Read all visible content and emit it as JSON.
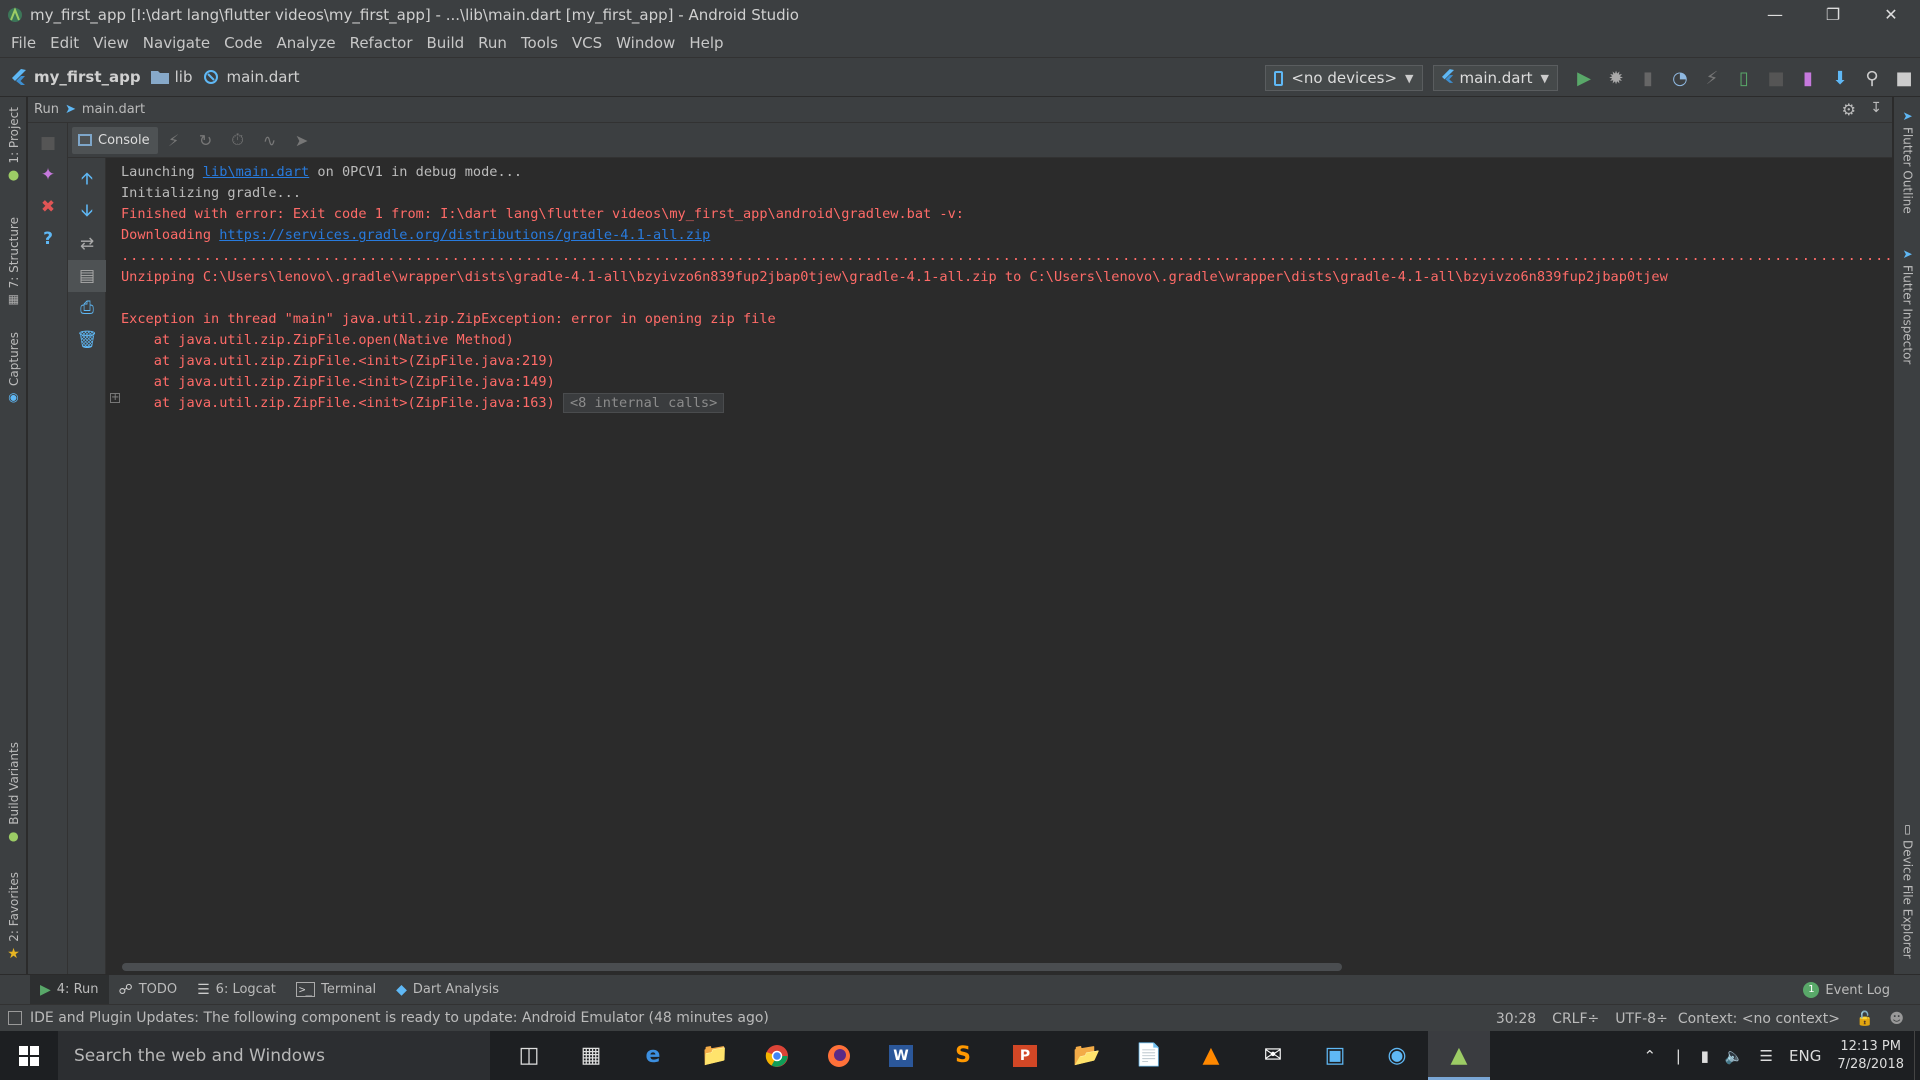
{
  "window": {
    "title": "my_first_app [I:\\dart lang\\flutter videos\\my_first_app] - ...\\lib\\main.dart [my_first_app] - Android Studio"
  },
  "menu": [
    "File",
    "Edit",
    "View",
    "Navigate",
    "Code",
    "Analyze",
    "Refactor",
    "Build",
    "Run",
    "Tools",
    "VCS",
    "Window",
    "Help"
  ],
  "breadcrumbs": [
    "my_first_app",
    "lib",
    "main.dart"
  ],
  "toolbar": {
    "device": "<no devices>",
    "run_config": "main.dart"
  },
  "left_tabs": [
    "1: Project",
    "7: Structure",
    "Captures",
    "Build Variants",
    "2: Favorites"
  ],
  "right_tabs": [
    "Flutter Outline",
    "Flutter Inspector",
    "Device File Explorer"
  ],
  "run_panel": {
    "label": "Run",
    "config": "main.dart",
    "console_tab": "Console"
  },
  "console": {
    "line1_prefix": "Launching ",
    "line1_link": "lib\\main.dart",
    "line1_suffix": " on 0PCV1 in debug mode...",
    "line2": "Initializing gradle...",
    "line3": "Finished with error: Exit code 1 from: I:\\dart lang\\flutter videos\\my_first_app\\android\\gradlew.bat -v:",
    "line4_prefix": "Downloading ",
    "line4_link": "https://services.gradle.org/distributions/gradle-4.1-all.zip",
    "dots": ".......................................................................................................................................................................................................................................",
    "line6": "Unzipping C:\\Users\\lenovo\\.gradle\\wrapper\\dists\\gradle-4.1-all\\bzyivzo6n839fup2jbap0tjew\\gradle-4.1-all.zip to C:\\Users\\lenovo\\.gradle\\wrapper\\dists\\gradle-4.1-all\\bzyivzo6n839fup2jbap0tjew",
    "line8": "Exception in thread \"main\" java.util.zip.ZipException: error in opening zip file",
    "line9": "    at java.util.zip.ZipFile.open(Native Method)",
    "line10": "    at java.util.zip.ZipFile.<init>(ZipFile.java:219)",
    "line11": "    at java.util.zip.ZipFile.<init>(ZipFile.java:149)",
    "line12": "    at java.util.zip.ZipFile.<init>(ZipFile.java:163)",
    "folded": "<8 internal calls>"
  },
  "bottom_tabs": [
    {
      "label": "4: Run",
      "icon": "run-icon"
    },
    {
      "label": "TODO",
      "icon": "todo-icon"
    },
    {
      "label": "6: Logcat",
      "icon": "logcat-icon"
    },
    {
      "label": "Terminal",
      "icon": "terminal-icon"
    },
    {
      "label": "Dart Analysis",
      "icon": "dart-icon"
    }
  ],
  "event_log": "Event Log",
  "status": {
    "message": "IDE and Plugin Updates: The following component is ready to update: Android Emulator (48 minutes ago)",
    "position": "30:28",
    "line_sep": "CRLF÷",
    "encoding": "UTF-8÷",
    "context": "Context: <no context>"
  },
  "taskbar": {
    "search_placeholder": "Search the web and Windows",
    "lang": "ENG",
    "time": "12:13 PM",
    "date": "7/28/2018"
  },
  "colors": {
    "error": "#ff6b68",
    "link": "#287bde",
    "run_green": "#59a869"
  }
}
